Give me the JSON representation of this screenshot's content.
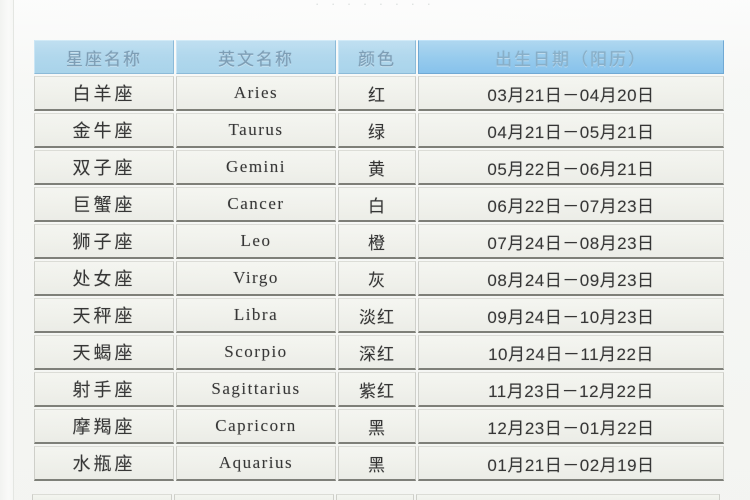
{
  "page": {
    "top_clipped_text": "· · ·   · ·   · · ·"
  },
  "table": {
    "columns": [
      {
        "key": "name",
        "label": "星座名称"
      },
      {
        "key": "en",
        "label": "英文名称"
      },
      {
        "key": "color",
        "label": "颜色"
      },
      {
        "key": "date",
        "label": "出生日期（阳历）"
      }
    ],
    "rows": [
      {
        "name": "白羊座",
        "en": "Aries",
        "color": "红",
        "date": "03月21日－04月20日"
      },
      {
        "name": "金牛座",
        "en": "Taurus",
        "color": "绿",
        "date": "04月21日－05月21日"
      },
      {
        "name": "双子座",
        "en": "Gemini",
        "color": "黄",
        "date": "05月22日－06月21日"
      },
      {
        "name": "巨蟹座",
        "en": "Cancer",
        "color": "白",
        "date": "06月22日－07月23日"
      },
      {
        "name": "狮子座",
        "en": "Leo",
        "color": "橙",
        "date": "07月24日－08月23日"
      },
      {
        "name": "处女座",
        "en": "Virgo",
        "color": "灰",
        "date": "08月24日－09月23日"
      },
      {
        "name": "天秤座",
        "en": "Libra",
        "color": "淡红",
        "date": "09月24日－10月23日"
      },
      {
        "name": "天蝎座",
        "en": "Scorpio",
        "color": "深红",
        "date": "10月24日－11月22日"
      },
      {
        "name": "射手座",
        "en": "Sagittarius",
        "color": "紫红",
        "date": "11月23日－12月22日"
      },
      {
        "name": "摩羯座",
        "en": "Capricorn",
        "color": "黑",
        "date": "12月23日－01月22日"
      },
      {
        "name": "水瓶座",
        "en": "Aquarius",
        "color": "黑",
        "date": "01月21日－02月19日"
      }
    ]
  },
  "colors": {
    "header_blue": "#a9d4ec",
    "header_blue_strong": "#79bbea",
    "header_text": "#6f93ad",
    "cell_background": "#f0f1eb",
    "cell_text": "#1e1e1e",
    "rule_line": "#6f7069",
    "page_background": "#f5f6f3"
  }
}
